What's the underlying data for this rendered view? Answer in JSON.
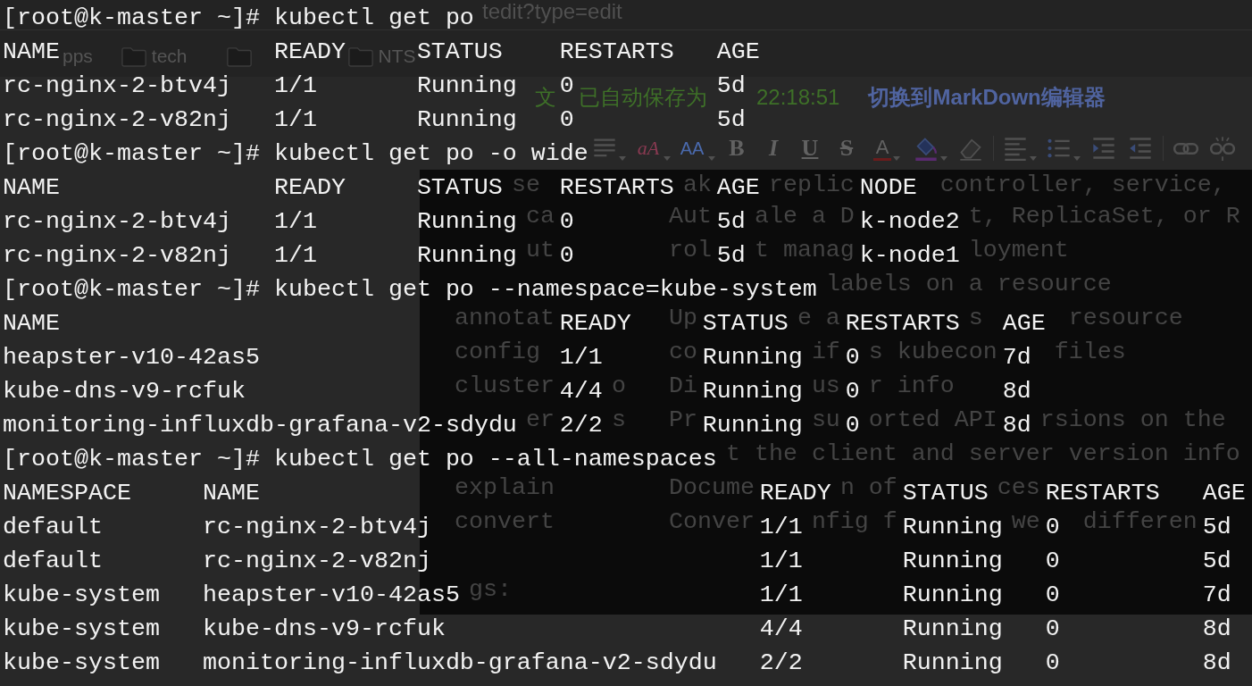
{
  "browser": {
    "url": "tedit?type=edit",
    "bookmarks": [
      {
        "kind": "apps",
        "label": "pps"
      },
      {
        "kind": "folder",
        "label": "tech"
      },
      {
        "kind": "folder"
      },
      {
        "kind": "folder",
        "label": "NTS"
      }
    ],
    "editor": {
      "autosave_note_parts": [
        "文",
        "已自动保存为",
        "22:18:51"
      ],
      "switch_link": "切换到MarkDown编辑器",
      "toolbar": [
        {
          "kind": "format"
        },
        {
          "kind": "spellcheck",
          "glyph": "aA"
        },
        {
          "kind": "font-size",
          "glyph": "AA"
        },
        {
          "kind": "bold",
          "glyph": "B"
        },
        {
          "kind": "italic",
          "glyph": "I"
        },
        {
          "kind": "underline",
          "glyph": "U"
        },
        {
          "kind": "strike",
          "glyph": "S"
        },
        {
          "kind": "font-color",
          "glyph": "A"
        },
        {
          "kind": "fill-color"
        },
        {
          "kind": "eraser"
        },
        {
          "kind": "separator"
        },
        {
          "kind": "align"
        },
        {
          "kind": "list"
        },
        {
          "kind": "indent"
        },
        {
          "kind": "outdent"
        },
        {
          "kind": "separator"
        },
        {
          "kind": "link"
        },
        {
          "kind": "unlink"
        }
      ]
    }
  },
  "help_terminal": {
    "rows": [
      {
        "name_parts": [
          "se"
        ],
        "description_parts": [
          "ak",
          "replic",
          "controller, service,"
        ]
      },
      {
        "name_parts": [
          "ca"
        ],
        "description_parts": [
          "Aut",
          "ale a D",
          "t, ReplicaSet, or R"
        ]
      },
      {
        "name_parts": [
          "ut"
        ],
        "description_parts": [
          "rol",
          "t manag",
          "loyment"
        ]
      },
      {
        "description_parts": [
          "labels on a resource"
        ]
      },
      {
        "name_parts": [
          "annotat"
        ],
        "description_parts": [
          "Up",
          "e a",
          "s",
          "resource"
        ]
      },
      {
        "name_parts": [
          "config"
        ],
        "description_parts": [
          "co",
          "if",
          "s kubecon",
          "files"
        ]
      },
      {
        "name_parts": [
          "cluster",
          "o"
        ],
        "description_parts": [
          "Di",
          "us",
          "r info"
        ]
      },
      {
        "name_parts": [
          "er",
          "s"
        ],
        "description_parts": [
          "Pr",
          "su",
          "orted API",
          "rsions on the"
        ]
      },
      {
        "description_parts": [
          "t the client and server version info"
        ]
      },
      {
        "name_parts": [
          "explain"
        ],
        "description_parts": [
          "Docume",
          "n of",
          "ces"
        ]
      },
      {
        "name_parts": [
          "convert"
        ],
        "description_parts": [
          "Conver",
          "nfig f",
          "we",
          "differen"
        ]
      }
    ],
    "flags_heading": "gs:"
  },
  "terminal": {
    "sessions": [
      {
        "prompt": "[root@k-master ~]#",
        "command": "kubectl get po",
        "columns": [
          "NAME",
          "READY",
          "STATUS",
          "RESTARTS",
          "AGE"
        ],
        "rows": [
          [
            "rc-nginx-2-btv4j",
            "1/1",
            "Running",
            "0",
            "5d"
          ],
          [
            "rc-nginx-2-v82nj",
            "1/1",
            "Running",
            "0",
            "5d"
          ]
        ]
      },
      {
        "prompt": "[root@k-master ~]#",
        "command": "kubectl get po -o wide",
        "columns": [
          "NAME",
          "READY",
          "STATUS",
          "RESTARTS",
          "AGE",
          "NODE"
        ],
        "rows": [
          [
            "rc-nginx-2-btv4j",
            "1/1",
            "Running",
            "0",
            "5d",
            "k-node2"
          ],
          [
            "rc-nginx-2-v82nj",
            "1/1",
            "Running",
            "0",
            "5d",
            "k-node1"
          ]
        ]
      },
      {
        "prompt": "[root@k-master ~]#",
        "command": "kubectl get po --namespace=kube-system",
        "columns": [
          "NAME",
          "READY",
          "STATUS",
          "RESTARTS",
          "AGE"
        ],
        "rows": [
          [
            "heapster-v10-42as5",
            "1/1",
            "Running",
            "0",
            "7d"
          ],
          [
            "kube-dns-v9-rcfuk",
            "4/4",
            "Running",
            "0",
            "8d"
          ],
          [
            "monitoring-influxdb-grafana-v2-sdydu",
            "2/2",
            "Running",
            "0",
            "8d"
          ]
        ]
      },
      {
        "prompt": "[root@k-master ~]#",
        "command": "kubectl get po --all-namespaces",
        "columns": [
          "NAMESPACE",
          "NAME",
          "READY",
          "STATUS",
          "RESTARTS",
          "AGE"
        ],
        "rows": [
          [
            "default",
            "rc-nginx-2-btv4j",
            "1/1",
            "Running",
            "0",
            "5d"
          ],
          [
            "default",
            "rc-nginx-2-v82nj",
            "1/1",
            "Running",
            "0",
            "5d"
          ],
          [
            "kube-system",
            "heapster-v10-42as5",
            "1/1",
            "Running",
            "0",
            "7d"
          ],
          [
            "kube-system",
            "kube-dns-v9-rcfuk",
            "4/4",
            "Running",
            "0",
            "8d"
          ],
          [
            "kube-system",
            "monitoring-influxdb-grafana-v2-sdydu",
            "2/2",
            "Running",
            "0",
            "8d"
          ]
        ]
      }
    ]
  }
}
